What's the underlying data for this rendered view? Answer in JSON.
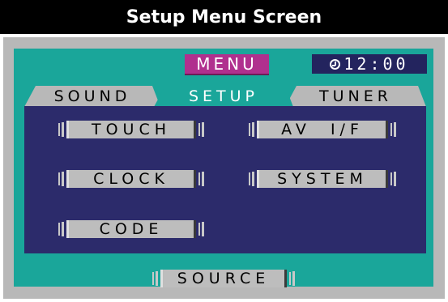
{
  "title": "Setup Menu Screen",
  "header": {
    "menu_label": "MENU",
    "clock_icon": "clock-icon",
    "time": "12:00"
  },
  "tabs": [
    {
      "label": "SOUND",
      "active": false
    },
    {
      "label": "SETUP",
      "active": true
    },
    {
      "label": "TUNER",
      "active": false
    }
  ],
  "buttons": {
    "touch": "TOUCH",
    "av_if": "AV  I/F",
    "clock": "CLOCK",
    "system": "SYSTEM",
    "code": "CODE"
  },
  "source_label": "SOURCE",
  "colors": {
    "screen": "#1aa69a",
    "panel": "#2c2b6b",
    "menu_badge": "#b0308e",
    "clock_badge": "#23245e"
  }
}
